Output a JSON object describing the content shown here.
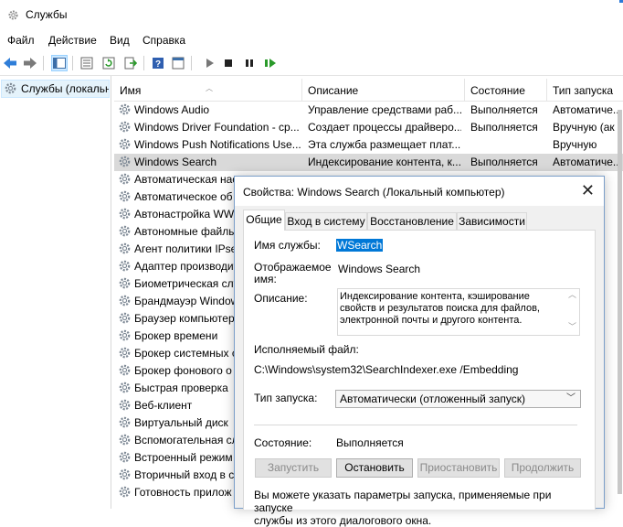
{
  "window": {
    "title": "Службы"
  },
  "menu": [
    "Файл",
    "Действие",
    "Вид",
    "Справка"
  ],
  "toolbar": {
    "icons": [
      "back-arrow-icon",
      "forward-arrow-icon",
      "show-tree-icon",
      "properties-icon",
      "refresh-icon",
      "export-list-icon",
      "help-icon",
      "console-icon",
      "play-icon",
      "stop-icon",
      "pause-icon",
      "resume-icon"
    ]
  },
  "left_pane": {
    "selected_label": "Службы (локальн"
  },
  "list": {
    "columns": [
      "Имя",
      "Описание",
      "Состояние",
      "Тип запуска"
    ],
    "rows": [
      {
        "name": "Windows Audio",
        "desc": "Управление средствами раб...",
        "state": "Выполняется",
        "start": "Автоматиче..."
      },
      {
        "name": "Windows Driver Foundation - ср...",
        "desc": "Создает процессы драйверо...",
        "state": "Выполняется",
        "start": "Вручную (ак"
      },
      {
        "name": "Windows Push Notifications Use...",
        "desc": "Эта служба размещает плат...",
        "state": "",
        "start": "Вручную"
      },
      {
        "name": "Windows Search",
        "desc": "Индексирование контента, к...",
        "state": "Выполняется",
        "start": "Автоматиче..."
      },
      {
        "name": "Автоматическая нас",
        "desc": "",
        "state": "",
        "start": ""
      },
      {
        "name": "Автоматическое об",
        "desc": "",
        "state": "",
        "start": ""
      },
      {
        "name": "Автонастройка WW",
        "desc": "",
        "state": "",
        "start": ""
      },
      {
        "name": "Автономные файлы",
        "desc": "",
        "state": "",
        "start": ""
      },
      {
        "name": "Агент политики IPse",
        "desc": "",
        "state": "",
        "start": ""
      },
      {
        "name": "Адаптер производит",
        "desc": "",
        "state": "",
        "start": ""
      },
      {
        "name": "Биометрическая слу",
        "desc": "",
        "state": "",
        "start": ""
      },
      {
        "name": "Брандмауэр Window",
        "desc": "",
        "state": "",
        "start": ""
      },
      {
        "name": "Браузер компьютер",
        "desc": "",
        "state": "",
        "start": ""
      },
      {
        "name": "Брокер времени",
        "desc": "",
        "state": "",
        "start": ""
      },
      {
        "name": "Брокер системных с",
        "desc": "",
        "state": "",
        "start": ""
      },
      {
        "name": "Брокер фонового о",
        "desc": "",
        "state": "",
        "start": ""
      },
      {
        "name": "Быстрая проверка",
        "desc": "",
        "state": "",
        "start": ""
      },
      {
        "name": "Веб-клиент",
        "desc": "",
        "state": "",
        "start": ""
      },
      {
        "name": "Виртуальный диск",
        "desc": "",
        "state": "",
        "start": ""
      },
      {
        "name": "Вспомогательная сл",
        "desc": "",
        "state": "",
        "start": ""
      },
      {
        "name": "Встроенный режим",
        "desc": "",
        "state": "",
        "start": ""
      },
      {
        "name": "Вторичный вход в с",
        "desc": "",
        "state": "",
        "start": ""
      },
      {
        "name": "Готовность прилож",
        "desc": "",
        "state": "",
        "start": ""
      }
    ],
    "selected_index": 3
  },
  "dialog": {
    "title": "Свойства: Windows Search (Локальный компьютер)",
    "tabs": [
      "Общие",
      "Вход в систему",
      "Восстановление",
      "Зависимости"
    ],
    "active_tab": 0,
    "service_name_label": "Имя службы:",
    "service_name_value": "WSearch",
    "display_name_label_1": "Отображаемое",
    "display_name_label_2": "имя:",
    "display_name_value": "Windows Search",
    "description_label": "Описание:",
    "description_lines": [
      "Индексирование контента, кэширование",
      "свойств и результатов поиска для файлов,",
      "электронной почты и другого контента."
    ],
    "exe_label": "Исполняемый файл:",
    "exe_value": "C:\\Windows\\system32\\SearchIndexer.exe /Embedding",
    "startup_label": "Тип запуска:",
    "startup_value": "Автоматически (отложенный запуск)",
    "status_label": "Состояние:",
    "status_value": "Выполняется",
    "buttons": [
      "Запустить",
      "Остановить",
      "Приостановить",
      "Продолжить"
    ],
    "note_lines": [
      "Вы можете указать параметры запуска, применяемые при запуске",
      "службы из этого диалогового окна."
    ]
  },
  "colors": {
    "selection": "#0078d7",
    "accent": "#2b79d8"
  }
}
